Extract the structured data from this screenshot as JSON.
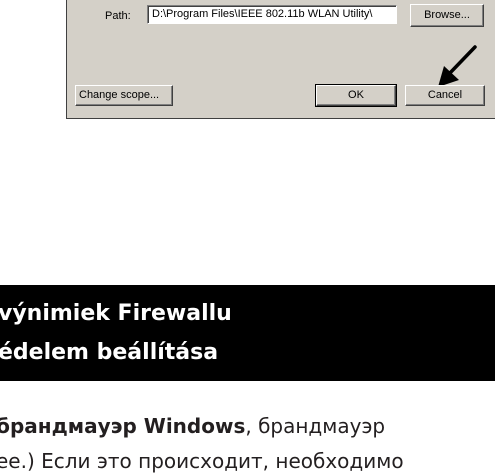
{
  "dialog": {
    "path_label": "Path:",
    "path_value": "D:\\Program Files\\IEEE 802.11b WLAN Utility\\",
    "browse_button": "Browse...",
    "change_scope_button": "Change scope...",
    "ok_button": "OK",
    "cancel_button": "Cancel",
    "pointer_icon": "arrow-pointer-icon"
  },
  "heading": {
    "line1": "výnimiek Firewallu",
    "line2": "édelem beállítása"
  },
  "body": {
    "line1_bold": "брандмауэр Windows",
    "line1_rest": ", брандмауэр",
    "line2": "ee.) Если это происходит, необходимо"
  },
  "colors": {
    "dialog_bg": "#d4d0c8",
    "heading_bg": "#000000",
    "heading_text": "#ffffff",
    "body_text": "#231f20"
  }
}
